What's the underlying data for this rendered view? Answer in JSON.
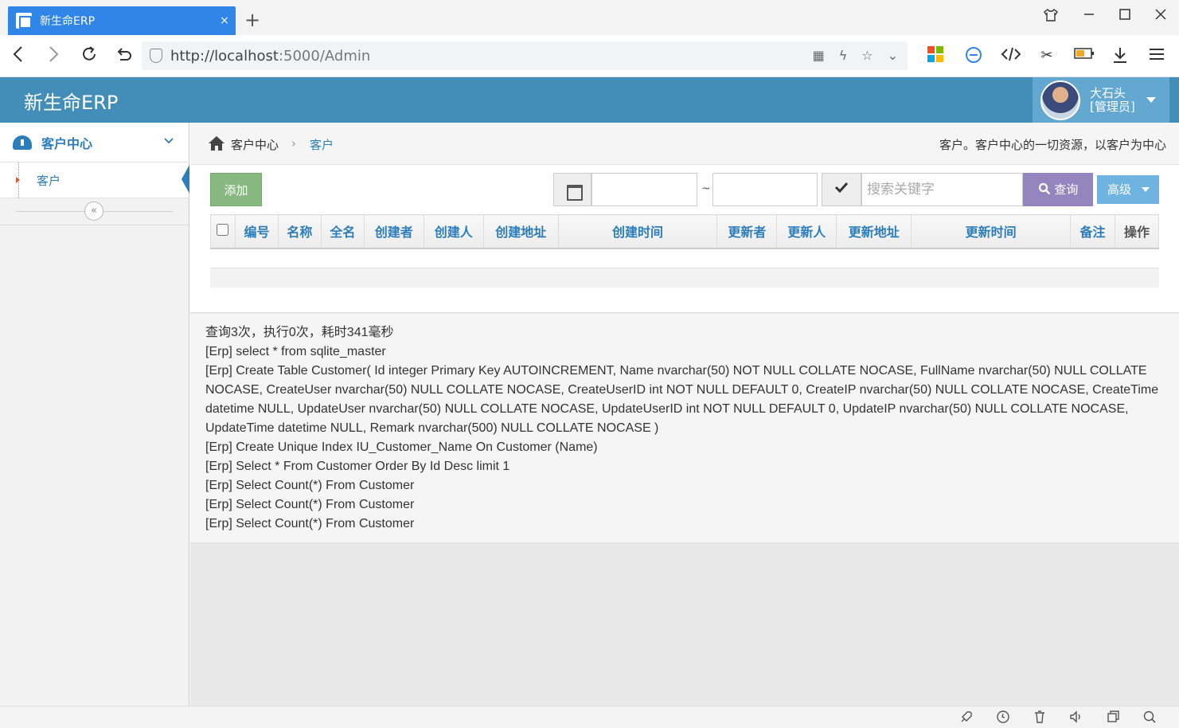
{
  "browser": {
    "tab_title": "新生命ERP",
    "tab_close": "×",
    "new_tab": "+",
    "url_host": "http://localhost",
    "url_rest": ":5000/Admin"
  },
  "header": {
    "brand": "新生命ERP",
    "user_name": "大石头",
    "user_role": "[管理员]"
  },
  "sidebar": {
    "group_label": "客户中心",
    "items": [
      {
        "label": "客户"
      }
    ],
    "collapse_icon": "«"
  },
  "breadcrumb": {
    "items": [
      "客户中心",
      "客户"
    ],
    "separator": "›",
    "description": "客户。客户中心的一切资源，以客户为中心"
  },
  "toolbar": {
    "add_label": "添加",
    "range_separator": "~",
    "search_placeholder": "搜索关键字",
    "query_label": "查询",
    "advanced_label": "高级"
  },
  "table": {
    "columns": [
      "编号",
      "名称",
      "全名",
      "创建者",
      "创建人",
      "创建地址",
      "创建时间",
      "更新者",
      "更新人",
      "更新地址",
      "更新时间",
      "备注",
      "操作"
    ]
  },
  "log": {
    "lines": [
      "查询3次，执行0次，耗时341毫秒",
      "[Erp] select * from sqlite_master",
      "[Erp] Create Table Customer( Id integer Primary Key AUTOINCREMENT, Name nvarchar(50) NOT NULL COLLATE NOCASE, FullName nvarchar(50) NULL COLLATE NOCASE, CreateUser nvarchar(50) NULL COLLATE NOCASE, CreateUserID int NOT NULL DEFAULT 0, CreateIP nvarchar(50) NULL COLLATE NOCASE, CreateTime datetime NULL, UpdateUser nvarchar(50) NULL COLLATE NOCASE, UpdateUserID int NOT NULL DEFAULT 0, UpdateIP nvarchar(50) NULL COLLATE NOCASE, UpdateTime datetime NULL, Remark nvarchar(500) NULL COLLATE NOCASE )",
      "[Erp] Create Unique Index IU_Customer_Name On Customer (Name)",
      "[Erp] Select * From Customer Order By Id Desc limit 1",
      "[Erp] Select Count(*) From Customer",
      "[Erp] Select Count(*) From Customer",
      "[Erp] Select Count(*) From Customer"
    ]
  },
  "colors": {
    "header": "#438eb9",
    "accent": "#2b7dbc",
    "add_button": "#87b87f",
    "query_button": "#9585bf",
    "advanced_button": "#6fb3e0"
  }
}
